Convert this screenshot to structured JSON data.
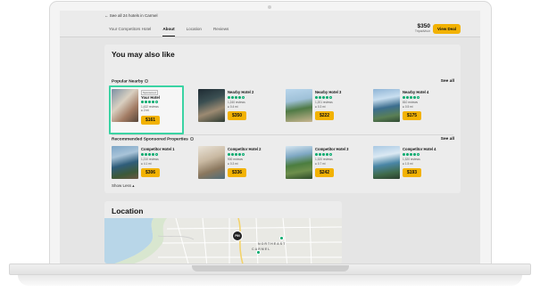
{
  "header": {
    "back_link": "See all 24 hotels in Carmel",
    "tabs": [
      {
        "label": "Your Competitors Hotel",
        "active": false
      },
      {
        "label": "About",
        "active": true
      },
      {
        "label": "Location",
        "active": false
      },
      {
        "label": "Reviews",
        "active": false
      }
    ],
    "price": "$350",
    "price_source": "Tripadvisor",
    "view_deal_label": "View Deal"
  },
  "may_also_like": {
    "title": "You may also like",
    "popular_nearby": {
      "heading": "Popular Nearby",
      "see_all": "See all",
      "hotels": [
        {
          "badge": "Sponsored",
          "name": "Your Hotel",
          "rating": 4,
          "reviews": "1,432 reviews",
          "distance": "2 mi",
          "price": "$161"
        },
        {
          "name": "Nearby Hotel 2",
          "rating": 4,
          "reviews": "1,240 reviews",
          "distance": "0.4 mi",
          "price": "$350"
        },
        {
          "name": "Nearby Hotel 3",
          "rating": 4,
          "reviews": "1,201 reviews",
          "distance": "0.3 mi",
          "price": "$222"
        },
        {
          "name": "Nearby Hotel 4",
          "rating": 4,
          "reviews": "810 reviews",
          "distance": "0.5 mi",
          "price": "$175"
        }
      ]
    },
    "sponsored": {
      "heading": "Recommended Sponsored Properties",
      "see_all": "See all",
      "hotels": [
        {
          "name": "Competitor Hotel 1",
          "rating": 4,
          "reviews": "1,210 reviews",
          "distance": "4.1 mi",
          "price": "$306"
        },
        {
          "name": "Competitor  Hotel 2",
          "rating": 4,
          "reviews": "900 reviews",
          "distance": "0.3 mi",
          "price": "$336"
        },
        {
          "name": "Competitor Hotel 3",
          "rating": 4,
          "reviews": "1,320 reviews",
          "distance": "0.7 mi",
          "price": "$242"
        },
        {
          "name": "Competitor Hotel 4",
          "rating": 4,
          "reviews": "1,320 reviews",
          "distance": "1.5 mi",
          "price": "$193"
        }
      ]
    },
    "show_less": "Show Less"
  },
  "location": {
    "title": "Location",
    "map_labels": [
      "NORTHEAST",
      "CARMEL"
    ],
    "map_pin": "PIN"
  },
  "colors": {
    "accent": "#f2b203",
    "rating": "#00aa6c",
    "highlight": "#3ad3a3"
  }
}
